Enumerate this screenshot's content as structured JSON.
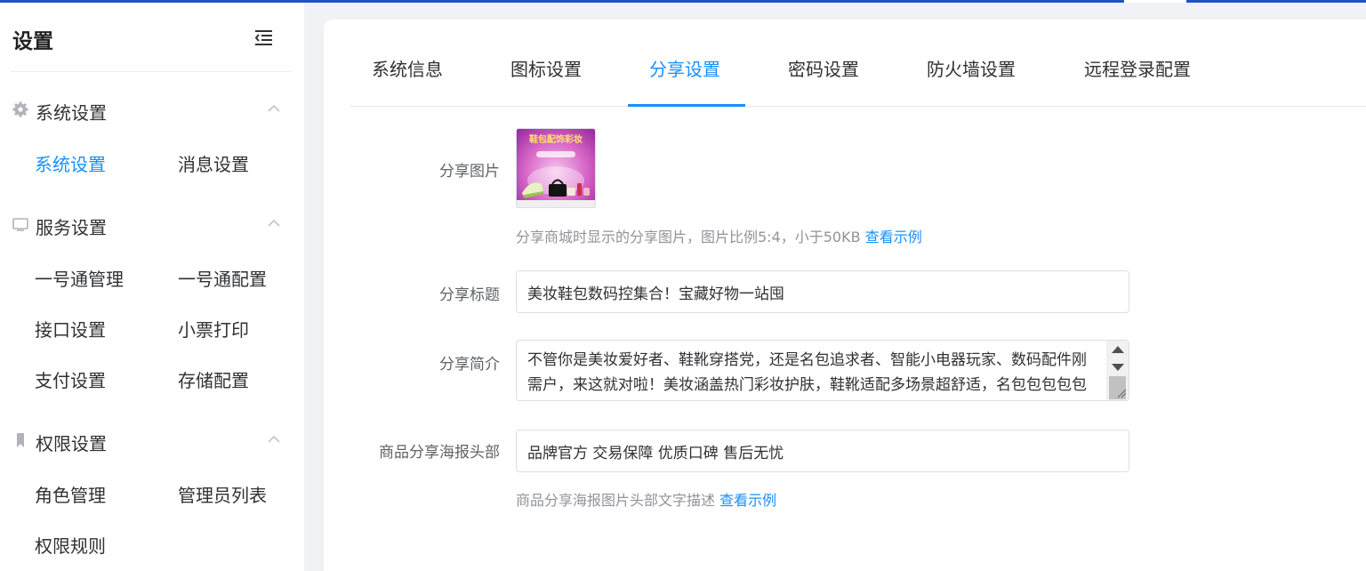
{
  "sidebar": {
    "title": "设置",
    "groups": [
      {
        "label": "系统设置",
        "icon": "gear-icon",
        "items": [
          "系统设置",
          "消息设置"
        ]
      },
      {
        "label": "服务设置",
        "icon": "monitor-icon",
        "items": [
          "一号通管理",
          "一号通配置",
          "接口设置",
          "小票打印",
          "支付设置",
          "存储配置"
        ]
      },
      {
        "label": "权限设置",
        "icon": "bookmark-icon",
        "items": [
          "角色管理",
          "管理员列表",
          "权限规则"
        ]
      }
    ]
  },
  "tabs": [
    "系统信息",
    "图标设置",
    "分享设置",
    "密码设置",
    "防火墙设置",
    "远程登录配置"
  ],
  "form": {
    "share_image": {
      "label": "分享图片",
      "image_text": "鞋包配饰彩妆",
      "hint": "分享商城时显示的分享图片，图片比例5:4，小于50KB",
      "hint_link": "查看示例"
    },
    "share_title": {
      "label": "分享标题",
      "value": "美妆鞋包数码控集合！宝藏好物一站囤"
    },
    "share_desc": {
      "label": "分享简介",
      "value": "不管你是美妆爱好者、鞋靴穿搭党，还是名包追求者、智能小电器玩家、数码配件刚需户，来这就对啦！美妆涵盖热门彩妆护肤，鞋靴适配多场景超舒适，名包包包包包"
    },
    "poster_header": {
      "label": "商品分享海报头部",
      "value": "品牌官方 交易保障 优质口碑 售后无忧",
      "hint": "商品分享海报图片头部文字描述",
      "hint_link": "查看示例"
    }
  },
  "colors": {
    "accent": "#1890ff",
    "topbar": "#1d55c4"
  }
}
